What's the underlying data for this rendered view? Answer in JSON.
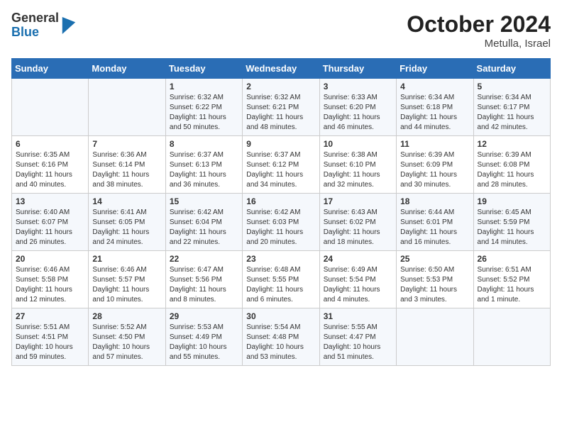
{
  "logo": {
    "general": "General",
    "blue": "Blue"
  },
  "title": "October 2024",
  "location": "Metulla, Israel",
  "days": [
    "Sunday",
    "Monday",
    "Tuesday",
    "Wednesday",
    "Thursday",
    "Friday",
    "Saturday"
  ],
  "weeks": [
    [
      {
        "day": null,
        "content": ""
      },
      {
        "day": null,
        "content": ""
      },
      {
        "day": 1,
        "content": "Sunrise: 6:32 AM\nSunset: 6:22 PM\nDaylight: 11 hours and 50 minutes."
      },
      {
        "day": 2,
        "content": "Sunrise: 6:32 AM\nSunset: 6:21 PM\nDaylight: 11 hours and 48 minutes."
      },
      {
        "day": 3,
        "content": "Sunrise: 6:33 AM\nSunset: 6:20 PM\nDaylight: 11 hours and 46 minutes."
      },
      {
        "day": 4,
        "content": "Sunrise: 6:34 AM\nSunset: 6:18 PM\nDaylight: 11 hours and 44 minutes."
      },
      {
        "day": 5,
        "content": "Sunrise: 6:34 AM\nSunset: 6:17 PM\nDaylight: 11 hours and 42 minutes."
      }
    ],
    [
      {
        "day": 6,
        "content": "Sunrise: 6:35 AM\nSunset: 6:16 PM\nDaylight: 11 hours and 40 minutes."
      },
      {
        "day": 7,
        "content": "Sunrise: 6:36 AM\nSunset: 6:14 PM\nDaylight: 11 hours and 38 minutes."
      },
      {
        "day": 8,
        "content": "Sunrise: 6:37 AM\nSunset: 6:13 PM\nDaylight: 11 hours and 36 minutes."
      },
      {
        "day": 9,
        "content": "Sunrise: 6:37 AM\nSunset: 6:12 PM\nDaylight: 11 hours and 34 minutes."
      },
      {
        "day": 10,
        "content": "Sunrise: 6:38 AM\nSunset: 6:10 PM\nDaylight: 11 hours and 32 minutes."
      },
      {
        "day": 11,
        "content": "Sunrise: 6:39 AM\nSunset: 6:09 PM\nDaylight: 11 hours and 30 minutes."
      },
      {
        "day": 12,
        "content": "Sunrise: 6:39 AM\nSunset: 6:08 PM\nDaylight: 11 hours and 28 minutes."
      }
    ],
    [
      {
        "day": 13,
        "content": "Sunrise: 6:40 AM\nSunset: 6:07 PM\nDaylight: 11 hours and 26 minutes."
      },
      {
        "day": 14,
        "content": "Sunrise: 6:41 AM\nSunset: 6:05 PM\nDaylight: 11 hours and 24 minutes."
      },
      {
        "day": 15,
        "content": "Sunrise: 6:42 AM\nSunset: 6:04 PM\nDaylight: 11 hours and 22 minutes."
      },
      {
        "day": 16,
        "content": "Sunrise: 6:42 AM\nSunset: 6:03 PM\nDaylight: 11 hours and 20 minutes."
      },
      {
        "day": 17,
        "content": "Sunrise: 6:43 AM\nSunset: 6:02 PM\nDaylight: 11 hours and 18 minutes."
      },
      {
        "day": 18,
        "content": "Sunrise: 6:44 AM\nSunset: 6:01 PM\nDaylight: 11 hours and 16 minutes."
      },
      {
        "day": 19,
        "content": "Sunrise: 6:45 AM\nSunset: 5:59 PM\nDaylight: 11 hours and 14 minutes."
      }
    ],
    [
      {
        "day": 20,
        "content": "Sunrise: 6:46 AM\nSunset: 5:58 PM\nDaylight: 11 hours and 12 minutes."
      },
      {
        "day": 21,
        "content": "Sunrise: 6:46 AM\nSunset: 5:57 PM\nDaylight: 11 hours and 10 minutes."
      },
      {
        "day": 22,
        "content": "Sunrise: 6:47 AM\nSunset: 5:56 PM\nDaylight: 11 hours and 8 minutes."
      },
      {
        "day": 23,
        "content": "Sunrise: 6:48 AM\nSunset: 5:55 PM\nDaylight: 11 hours and 6 minutes."
      },
      {
        "day": 24,
        "content": "Sunrise: 6:49 AM\nSunset: 5:54 PM\nDaylight: 11 hours and 4 minutes."
      },
      {
        "day": 25,
        "content": "Sunrise: 6:50 AM\nSunset: 5:53 PM\nDaylight: 11 hours and 3 minutes."
      },
      {
        "day": 26,
        "content": "Sunrise: 6:51 AM\nSunset: 5:52 PM\nDaylight: 11 hours and 1 minute."
      }
    ],
    [
      {
        "day": 27,
        "content": "Sunrise: 5:51 AM\nSunset: 4:51 PM\nDaylight: 10 hours and 59 minutes."
      },
      {
        "day": 28,
        "content": "Sunrise: 5:52 AM\nSunset: 4:50 PM\nDaylight: 10 hours and 57 minutes."
      },
      {
        "day": 29,
        "content": "Sunrise: 5:53 AM\nSunset: 4:49 PM\nDaylight: 10 hours and 55 minutes."
      },
      {
        "day": 30,
        "content": "Sunrise: 5:54 AM\nSunset: 4:48 PM\nDaylight: 10 hours and 53 minutes."
      },
      {
        "day": 31,
        "content": "Sunrise: 5:55 AM\nSunset: 4:47 PM\nDaylight: 10 hours and 51 minutes."
      },
      {
        "day": null,
        "content": ""
      },
      {
        "day": null,
        "content": ""
      }
    ]
  ]
}
